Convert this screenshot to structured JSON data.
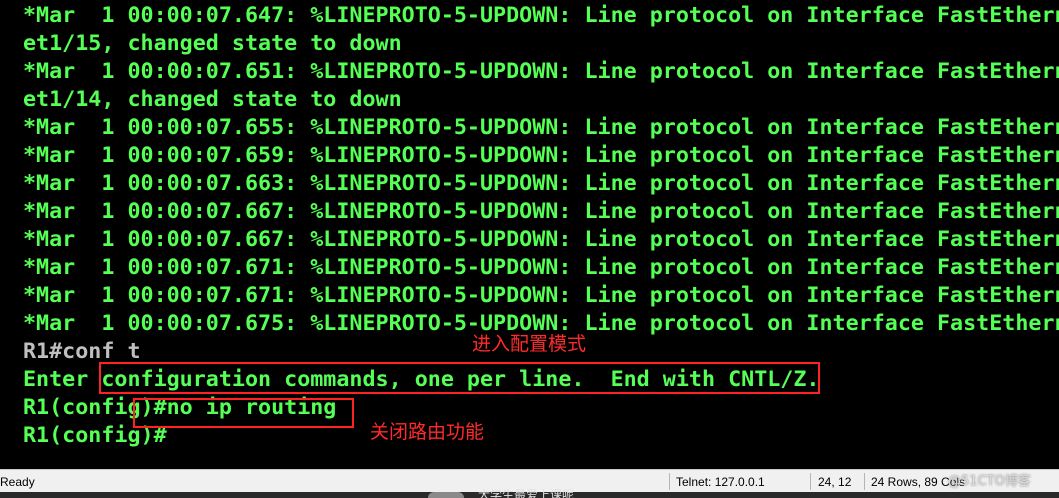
{
  "terminal": {
    "lines": [
      {
        "text": "*Mar  1 00:00:07.647: %LINEPROTO-5-UPDOWN: Line protocol on Interface FastEthern"
      },
      {
        "text": "et1/15, changed state to down"
      },
      {
        "text": "*Mar  1 00:00:07.651: %LINEPROTO-5-UPDOWN: Line protocol on Interface FastEthern"
      },
      {
        "text": "et1/14, changed state to down"
      },
      {
        "text": "*Mar  1 00:00:07.655: %LINEPROTO-5-UPDOWN: Line protocol on Interface FastEthern"
      },
      {
        "text": "*Mar  1 00:00:07.659: %LINEPROTO-5-UPDOWN: Line protocol on Interface FastEthern"
      },
      {
        "text": "*Mar  1 00:00:07.663: %LINEPROTO-5-UPDOWN: Line protocol on Interface FastEthern"
      },
      {
        "text": "*Mar  1 00:00:07.667: %LINEPROTO-5-UPDOWN: Line protocol on Interface FastEthern"
      },
      {
        "text": "*Mar  1 00:00:07.667: %LINEPROTO-5-UPDOWN: Line protocol on Interface FastEthern"
      },
      {
        "text": "*Mar  1 00:00:07.671: %LINEPROTO-5-UPDOWN: Line protocol on Interface FastEthern"
      },
      {
        "text": "*Mar  1 00:00:07.671: %LINEPROTO-5-UPDOWN: Line protocol on Interface FastEthern"
      },
      {
        "text": "*Mar  1 00:00:07.675: %LINEPROTO-5-UPDOWN: Line protocol on Interface FastEthern"
      },
      {
        "text": "R1#conf t"
      },
      {
        "text": "Enter configuration commands, one per line.  End with CNTL/Z."
      },
      {
        "text": "R1(config)#no ip routing"
      },
      {
        "text": "R1(config)#"
      }
    ],
    "colors": {
      "background": "#000000",
      "log_text": "#55ff55",
      "prompt_text": "#bfbfbf",
      "annotation": "#ff2222"
    }
  },
  "annotations": {
    "config_mode_label": "进入配置模式",
    "disable_routing_label": "关闭路由功能"
  },
  "statusbar": {
    "ready": "Ready",
    "connection": "Telnet: 127.0.0.1",
    "cursor": "24,  12",
    "size": "24 Rows, 89 Cols"
  },
  "watermark": "@51CTO博客",
  "taskbar_partial_text": "大学生最爱上课呢"
}
